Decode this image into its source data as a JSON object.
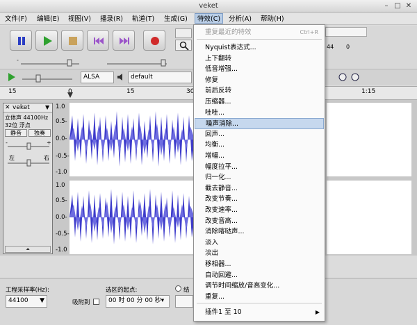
{
  "window": {
    "title": "veket",
    "minimize": "–",
    "maximize": "□",
    "close": "✕"
  },
  "menubar": [
    {
      "label": "文件(F)"
    },
    {
      "label": "编辑(E)"
    },
    {
      "label": "视图(V)"
    },
    {
      "label": "播录(R)"
    },
    {
      "label": "轨道(T)"
    },
    {
      "label": "生成(G)"
    },
    {
      "label": "特效(C)",
      "active": true
    },
    {
      "label": "分析(A)"
    },
    {
      "label": "帮助(H)"
    }
  ],
  "transport": {
    "pause": "pause-icon",
    "play": "play-icon",
    "stop": "stop-icon",
    "skip_start": "skip-start-icon",
    "skip_end": "skip-end-icon",
    "record": "record-icon"
  },
  "device": {
    "host": "ALSA",
    "output": "default",
    "meter_right_value": "44",
    "meter_right_unit": "0"
  },
  "ruler": {
    "ticks": [
      "15",
      "0",
      "15",
      "30",
      "1:15"
    ]
  },
  "track": {
    "name": "veket",
    "info1": "立体声  44100Hz",
    "info2": "32位 浮点",
    "mute": "静音",
    "solo": "独奏",
    "pan_left": "左",
    "pan_right": "右",
    "gain_minus": "-",
    "gain_plus": "+",
    "y_labels_top": [
      "1.0",
      "0.5-",
      "0.0-",
      "-0.5-",
      "-1.0"
    ],
    "y_labels_bottom": [
      "1.0",
      "0.5-",
      "0.0-",
      "-0.5-",
      "-1.0"
    ]
  },
  "bottombar": {
    "rate_label": "工程采样率(Hz):",
    "rate_value": "44100",
    "snap_label": "吸附到",
    "selection_label": "选区的起点:",
    "end_label": "结",
    "time_value": "00 时 00 分 00 秒▾"
  },
  "effect_menu": {
    "repeat_last": "重复最近的特效",
    "repeat_shortcut": "Ctrl+R",
    "items": [
      "Nyquist表达式...",
      "上下翻转",
      "低音增强...",
      "修复",
      "前后反转",
      "压缩器...",
      "哇哇...",
      "噪声消除...",
      "回声...",
      "均衡...",
      "增幅...",
      "幅度拉平...",
      "归一化...",
      "截去静音...",
      "改变节奏...",
      "改变速率...",
      "改变音高...",
      "消除喀哒声...",
      "淡入",
      "淡出",
      "移相器...",
      "自动回避...",
      "调节时间缩放/音高变化...",
      "重复..."
    ],
    "highlighted_index": 7,
    "plugins": "插件1 至 10",
    "submenu_arrow": "▶"
  },
  "colors": {
    "wave": "#3e3ccb",
    "wave_light": "#6d6ce0",
    "menu_highlight": "#c6d8ee"
  }
}
